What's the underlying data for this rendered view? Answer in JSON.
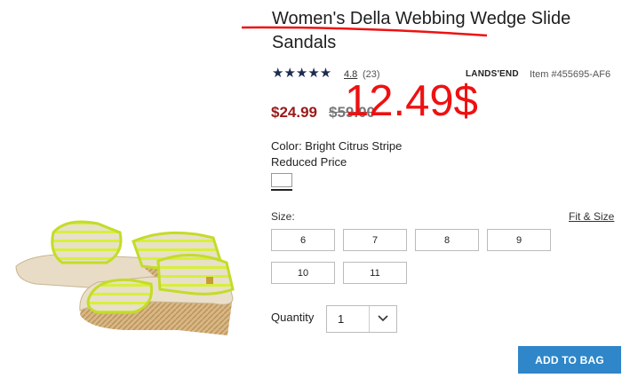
{
  "product": {
    "title": "Women's Della Webbing Wedge Slide Sandals",
    "stars": "★★★★★",
    "rating": "4.8",
    "review_count": "(23)",
    "brand": "LANDS'END",
    "item_number": "Item #455695-AF6",
    "sale_price": "$24.99",
    "original_price": "$59.00",
    "color_label": "Color: Bright Citrus Stripe",
    "reduced_label": "Reduced Price"
  },
  "annotation": {
    "price_note": "12.49$",
    "color": "#ee1111"
  },
  "size": {
    "label": "Size:",
    "fit_link": "Fit & Size",
    "options": [
      "6",
      "7",
      "8",
      "9",
      "10",
      "11"
    ]
  },
  "quantity": {
    "label": "Quantity",
    "value": "1"
  },
  "actions": {
    "add_to_bag": "ADD TO BAG"
  },
  "colors": {
    "sale": "#9b1a1a",
    "accent_button": "#2f86c9",
    "stars": "#1d2b52",
    "sandal_strap": "#d6f03a"
  }
}
